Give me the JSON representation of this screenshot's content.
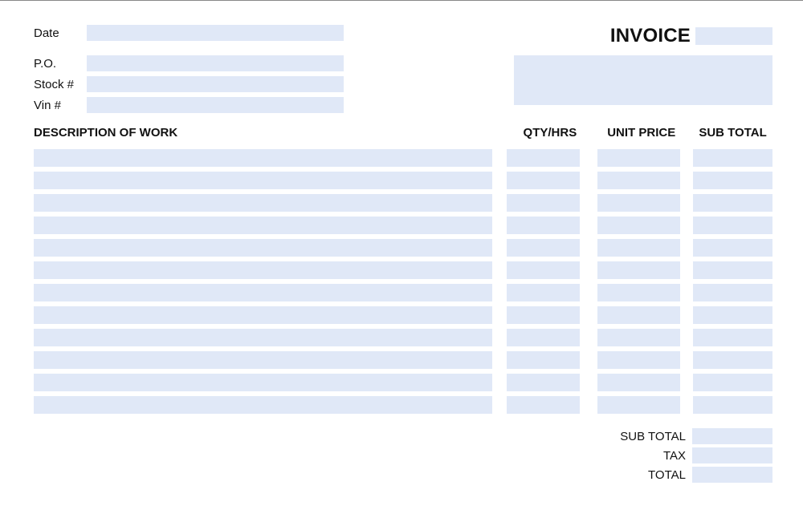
{
  "header": {
    "title": "INVOICE",
    "invoice_number": "",
    "fields": {
      "date_label": "Date",
      "date_value": "",
      "po_label": "P.O.",
      "po_value": "",
      "stock_label": "Stock #",
      "stock_value": "",
      "vin_label": "Vin #",
      "vin_value": "",
      "address_block": ""
    }
  },
  "table": {
    "columns": {
      "description": "DESCRIPTION OF WORK",
      "qty": "QTY/HRS",
      "unit_price": "UNIT PRICE",
      "subtotal": "SUB TOTAL"
    },
    "rows": [
      {
        "description": "",
        "qty": "",
        "unit_price": "",
        "subtotal": ""
      },
      {
        "description": "",
        "qty": "",
        "unit_price": "",
        "subtotal": ""
      },
      {
        "description": "",
        "qty": "",
        "unit_price": "",
        "subtotal": ""
      },
      {
        "description": "",
        "qty": "",
        "unit_price": "",
        "subtotal": ""
      },
      {
        "description": "",
        "qty": "",
        "unit_price": "",
        "subtotal": ""
      },
      {
        "description": "",
        "qty": "",
        "unit_price": "",
        "subtotal": ""
      },
      {
        "description": "",
        "qty": "",
        "unit_price": "",
        "subtotal": ""
      },
      {
        "description": "",
        "qty": "",
        "unit_price": "",
        "subtotal": ""
      },
      {
        "description": "",
        "qty": "",
        "unit_price": "",
        "subtotal": ""
      },
      {
        "description": "",
        "qty": "",
        "unit_price": "",
        "subtotal": ""
      },
      {
        "description": "",
        "qty": "",
        "unit_price": "",
        "subtotal": ""
      },
      {
        "description": "",
        "qty": "",
        "unit_price": "",
        "subtotal": ""
      }
    ]
  },
  "totals": {
    "subtotal_label": "SUB TOTAL",
    "subtotal_value": "",
    "tax_label": "TAX",
    "tax_value": "",
    "total_label": "TOTAL",
    "total_value": ""
  }
}
